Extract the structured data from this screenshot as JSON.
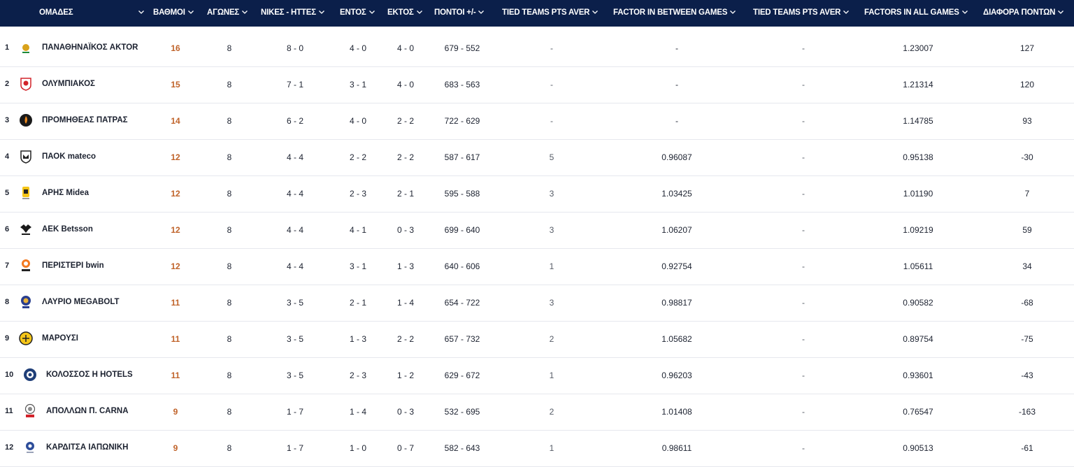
{
  "headers": {
    "teams": "ΟΜΑΔΕΣ",
    "points": "ΒΑΘΜΟΙ",
    "games": "ΑΓΩΝΕΣ",
    "wl": "ΝΙΚΕΣ - ΗΤΤΕΣ",
    "home": "ΕΝΤΟΣ",
    "away": "ΕΚΤΟΣ",
    "pf": "ΠΟΝΤΟΙ +/-",
    "tied1": "TIED TEAMS PTS AVER",
    "factor_between": "FACTOR IN BETWEEN GAMES",
    "tied2": "TIED TEAMS PTS AVER",
    "factor_all": "FACTORS IN ALL GAMES",
    "diff": "ΔΙΑΦΟΡΑ ΠΟΝΤΩΝ"
  },
  "colors": {
    "header_bg": "#0b1f4a",
    "points": "#c0632a",
    "row_border": "#e6e8ee"
  },
  "rows": [
    {
      "rank": "1",
      "logo": "panathinaikos-logo",
      "team": "ΠΑΝΑΘΗΝΑΪΚΟΣ AKTOR",
      "points": "16",
      "games": "8",
      "wl": "8 - 0",
      "home": "4 - 0",
      "away": "4 - 0",
      "pf": "679 - 552",
      "tied1": "-",
      "factor_between": "-",
      "tied2": "-",
      "factor_all": "1.23007",
      "diff": "127"
    },
    {
      "rank": "2",
      "logo": "olympiakos-logo",
      "team": "ΟΛΥΜΠΙΑΚΟΣ",
      "points": "15",
      "games": "8",
      "wl": "7 - 1",
      "home": "3 - 1",
      "away": "4 - 0",
      "pf": "683 - 563",
      "tied1": "-",
      "factor_between": "-",
      "tied2": "-",
      "factor_all": "1.21314",
      "diff": "120"
    },
    {
      "rank": "3",
      "logo": "promitheas-logo",
      "team": "ΠΡΟΜΗΘΕΑΣ ΠΑΤΡΑΣ",
      "points": "14",
      "games": "8",
      "wl": "6 - 2",
      "home": "4 - 0",
      "away": "2 - 2",
      "pf": "722 - 629",
      "tied1": "-",
      "factor_between": "-",
      "tied2": "-",
      "factor_all": "1.14785",
      "diff": "93"
    },
    {
      "rank": "4",
      "logo": "paok-logo",
      "team": "ΠΑΟΚ mateco",
      "points": "12",
      "games": "8",
      "wl": "4 - 4",
      "home": "2 - 2",
      "away": "2 - 2",
      "pf": "587 - 617",
      "tied1": "5",
      "factor_between": "0.96087",
      "tied2": "-",
      "factor_all": "0.95138",
      "diff": "-30"
    },
    {
      "rank": "5",
      "logo": "aris-logo",
      "team": "ΑΡΗΣ Midea",
      "points": "12",
      "games": "8",
      "wl": "4 - 4",
      "home": "2 - 3",
      "away": "2 - 1",
      "pf": "595 - 588",
      "tied1": "3",
      "factor_between": "1.03425",
      "tied2": "-",
      "factor_all": "1.01190",
      "diff": "7"
    },
    {
      "rank": "6",
      "logo": "aek-logo",
      "team": "AEK Betsson",
      "points": "12",
      "games": "8",
      "wl": "4 - 4",
      "home": "4 - 1",
      "away": "0 - 3",
      "pf": "699 - 640",
      "tied1": "3",
      "factor_between": "1.06207",
      "tied2": "-",
      "factor_all": "1.09219",
      "diff": "59"
    },
    {
      "rank": "7",
      "logo": "peristeri-logo",
      "team": "ΠΕΡΙΣΤΕΡΙ bwin",
      "points": "12",
      "games": "8",
      "wl": "4 - 4",
      "home": "3 - 1",
      "away": "1 - 3",
      "pf": "640 - 606",
      "tied1": "1",
      "factor_between": "0.92754",
      "tied2": "-",
      "factor_all": "1.05611",
      "diff": "34"
    },
    {
      "rank": "8",
      "logo": "lavrio-logo",
      "team": "ΛΑΥΡΙΟ MEGABOLT",
      "points": "11",
      "games": "8",
      "wl": "3 - 5",
      "home": "2 - 1",
      "away": "1 - 4",
      "pf": "654 - 722",
      "tied1": "3",
      "factor_between": "0.98817",
      "tied2": "-",
      "factor_all": "0.90582",
      "diff": "-68"
    },
    {
      "rank": "9",
      "logo": "marousi-logo",
      "team": "ΜΑΡΟΥΣΙ",
      "points": "11",
      "games": "8",
      "wl": "3 - 5",
      "home": "1 - 3",
      "away": "2 - 2",
      "pf": "657 - 732",
      "tied1": "2",
      "factor_between": "1.05682",
      "tied2": "-",
      "factor_all": "0.89754",
      "diff": "-75"
    },
    {
      "rank": "10",
      "logo": "kolossos-logo",
      "team": "ΚΟΛΟΣΣΟΣ H HOTELS",
      "points": "11",
      "games": "8",
      "wl": "3 - 5",
      "home": "2 - 3",
      "away": "1 - 2",
      "pf": "629 - 672",
      "tied1": "1",
      "factor_between": "0.96203",
      "tied2": "-",
      "factor_all": "0.93601",
      "diff": "-43"
    },
    {
      "rank": "11",
      "logo": "apollon-logo",
      "team": "ΑΠΟΛΛΩΝ Π. CARNA",
      "points": "9",
      "games": "8",
      "wl": "1 - 7",
      "home": "1 - 4",
      "away": "0 - 3",
      "pf": "532 - 695",
      "tied1": "2",
      "factor_between": "1.01408",
      "tied2": "-",
      "factor_all": "0.76547",
      "diff": "-163"
    },
    {
      "rank": "12",
      "logo": "karditsa-logo",
      "team": "ΚΑΡΔΙΤΣΑ ΙΑΠΩΝΙΚΗ",
      "points": "9",
      "games": "8",
      "wl": "1 - 7",
      "home": "1 - 0",
      "away": "0 - 7",
      "pf": "582 - 643",
      "tied1": "1",
      "factor_between": "0.98611",
      "tied2": "-",
      "factor_all": "0.90513",
      "diff": "-61"
    }
  ]
}
